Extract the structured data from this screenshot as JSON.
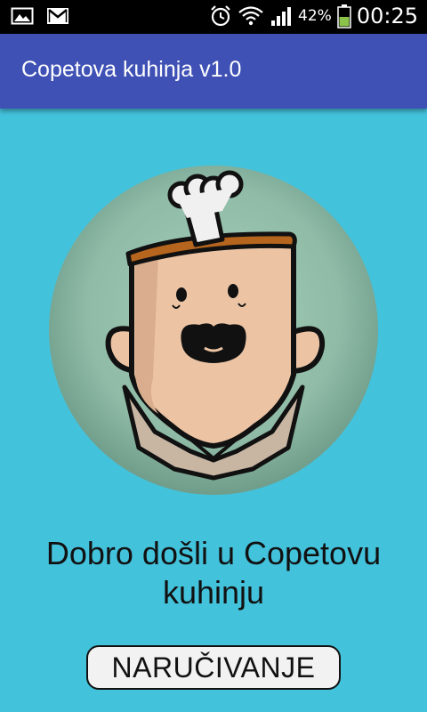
{
  "status_bar": {
    "left_icons": [
      "image-icon",
      "gmail-icon"
    ],
    "right_icons": [
      "alarm-icon",
      "wifi-icon",
      "signal-icon",
      "battery-icon"
    ],
    "battery_percent": "42%",
    "time": "00:25"
  },
  "app_bar": {
    "title": "Copetova kuhinja v1.0",
    "color": "#3f51b5"
  },
  "main": {
    "background_color": "#43c2dc",
    "avatar_icon": "chef-character-icon",
    "welcome_text": "Dobro došli u Copetovu kuhinju",
    "order_button_label": "NARUČIVANJE"
  }
}
